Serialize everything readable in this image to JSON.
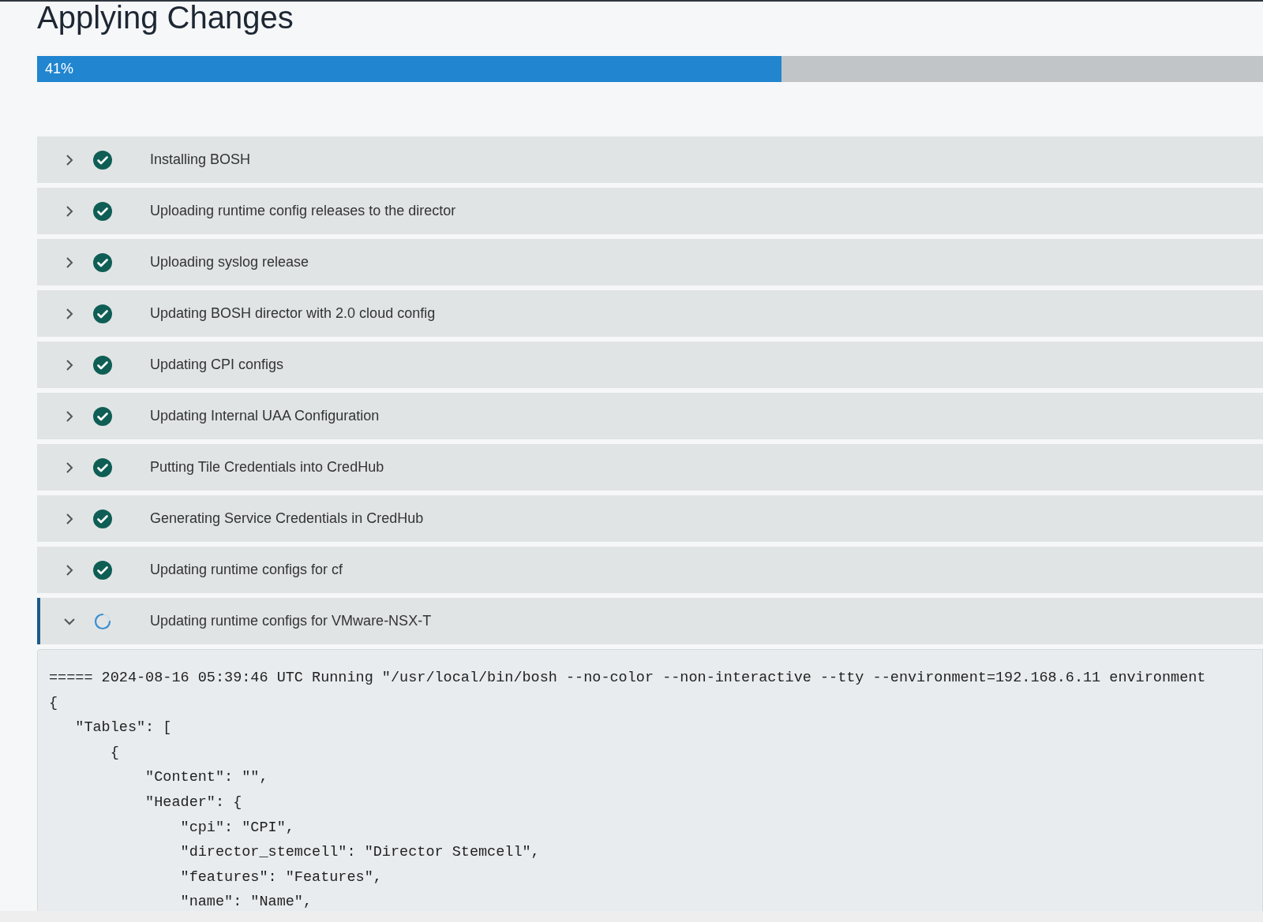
{
  "page": {
    "title": "Applying Changes"
  },
  "progress": {
    "label": "41%",
    "level": 0.607
  },
  "steps": [
    {
      "label": "Installing BOSH",
      "kind": "done",
      "expanded": false
    },
    {
      "label": "Uploading runtime config releases to the director",
      "kind": "done",
      "expanded": false
    },
    {
      "label": "Uploading syslog release",
      "kind": "done",
      "expanded": false
    },
    {
      "label": "Updating BOSH director with 2.0 cloud config",
      "kind": "done",
      "expanded": false
    },
    {
      "label": "Updating CPI configs",
      "kind": "done",
      "expanded": false
    },
    {
      "label": "Updating Internal UAA Configuration",
      "kind": "done",
      "expanded": false
    },
    {
      "label": "Putting Tile Credentials into CredHub",
      "kind": "done",
      "expanded": false
    },
    {
      "label": "Generating Service Credentials in CredHub",
      "kind": "done",
      "expanded": false
    },
    {
      "label": "Updating runtime configs for cf",
      "kind": "done",
      "expanded": false
    },
    {
      "label": "Updating runtime configs for VMware-NSX-T",
      "kind": "running",
      "expanded": true,
      "log": [
        "===== 2024-08-16 05:39:46 UTC Running \"/usr/local/bin/bosh --no-color --non-interactive --tty --environment=192.168.6.11 environment",
        "{",
        "   \"Tables\": [",
        "       {",
        "           \"Content\": \"\",",
        "           \"Header\": {",
        "               \"cpi\": \"CPI\",",
        "               \"director_stemcell\": \"Director Stemcell\",",
        "               \"features\": \"Features\",",
        "               \"name\": \"Name\","
      ]
    }
  ]
}
